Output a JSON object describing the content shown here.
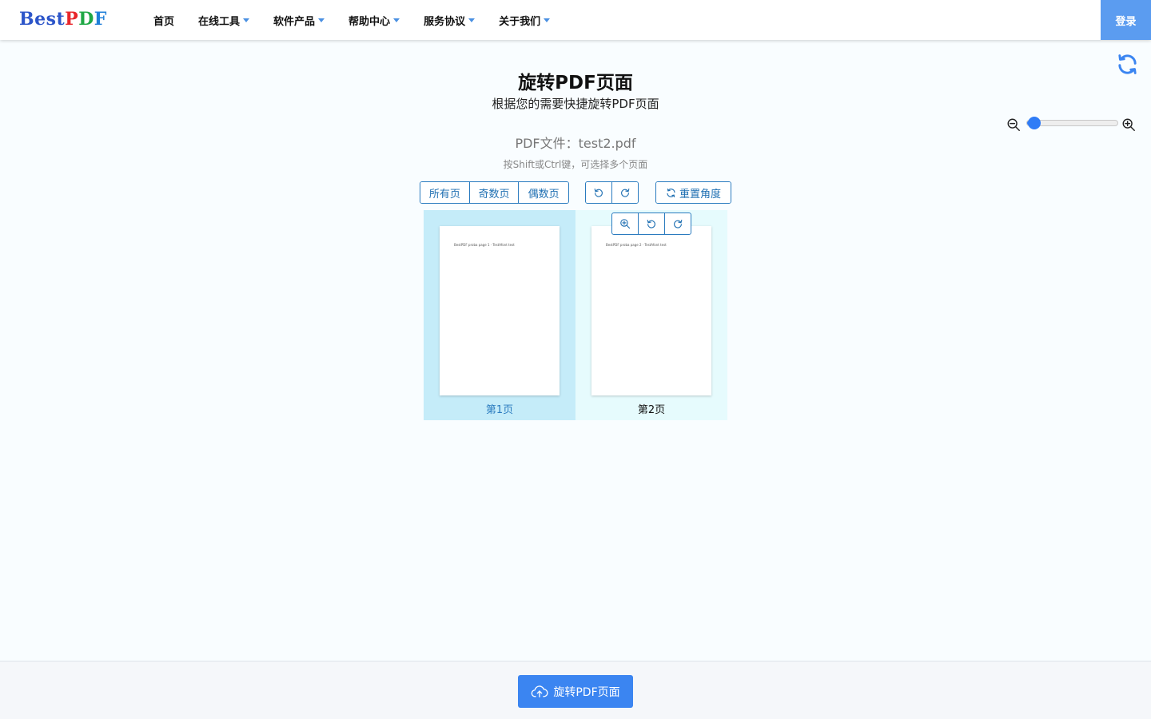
{
  "header": {
    "logo": {
      "best": "Best",
      "p": "P",
      "d": "D",
      "f": "F"
    },
    "nav": [
      {
        "label": "首页",
        "dropdown": false
      },
      {
        "label": "在线工具",
        "dropdown": true
      },
      {
        "label": "软件产品",
        "dropdown": true
      },
      {
        "label": "帮助中心",
        "dropdown": true
      },
      {
        "label": "服务协议",
        "dropdown": true
      },
      {
        "label": "关于我们",
        "dropdown": true
      }
    ],
    "login_label": "登录"
  },
  "zoom": {
    "level": 0.08
  },
  "main": {
    "title": "旋转PDF页面",
    "subtitle": "根据您的需要快捷旋转PDF页面",
    "file_label": "PDF文件：test2.pdf",
    "hint": "按Shift或Ctrl键，可选择多个页面"
  },
  "toolbar": {
    "all_pages": "所有页",
    "odd_pages": "奇数页",
    "even_pages": "偶数页",
    "reset_angle": "重置角度"
  },
  "pages": [
    {
      "label": "第1页",
      "text": "BestPDF proba page 1 · TestAfont test",
      "selected": true
    },
    {
      "label": "第2页",
      "text": "BestPDF proba page 2 · TestAfont test",
      "selected": false
    }
  ],
  "footer": {
    "submit_label": "旋转PDF页面"
  },
  "colors": {
    "accent": "#3b85f1",
    "border": "#2a7bbf",
    "selected_bg": "#c5ecf9"
  }
}
